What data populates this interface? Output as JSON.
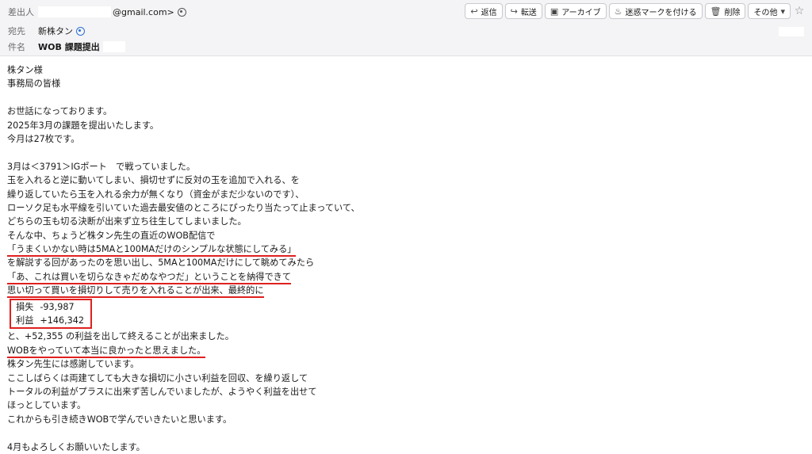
{
  "header": {
    "from_label": "差出人",
    "from_value": "@gmail.com>",
    "to_label": "宛先",
    "to_value": "新株タン",
    "subject_label": "件名",
    "subject_value": "WOB 課題提出"
  },
  "toolbar": {
    "reply": "返信",
    "forward": "転送",
    "archive": "アーカイブ",
    "junk": "迷惑マークを付ける",
    "delete": "削除",
    "more": "その他"
  },
  "body": {
    "greeting1": "株タン様",
    "greeting2": "事務局の皆様",
    "p1_1": "お世話になっております。",
    "p1_2": "2025年3月の課題を提出いたします。",
    "p1_3": "今月は27枚です。",
    "p2_1": "3月は＜3791＞IGポート　で戦っていました。",
    "p2_2": "玉を入れると逆に動いてしまい、損切せずに反対の玉を追加で入れる、を",
    "p2_3": "繰り返していたら玉を入れる余力が無くなり（資金がまだ少ないのです）、",
    "p2_4": "ローソク足も水平線を引いていた過去最安値のところにぴったり当たって止まっていて、",
    "p2_5": "どちらの玉も切る決断が出来ず立ち往生してしまいました。",
    "p2_6": "そんな中、ちょうど株タン先生の直近のWOB配信で",
    "p2_7": "「うまくいかない時は5MAと100MAだけのシンプルな状態にしてみる」",
    "p2_8": "を解説する回があったのを思い出し、5MAと100MAだけにして眺めてみたら",
    "p2_9": "「あ、これは買いを切らなきゃだめなやつだ」ということを納得できて",
    "p2_10": "思い切って買いを損切りして売りを入れることが出来、最終的に",
    "loss_label": "損失",
    "loss_value": "-93,987",
    "profit_label": "利益",
    "profit_value": "+146,342",
    "p2_11": "と、+52,355 の利益を出して終えることが出来ました。",
    "p2_12": "WOBをやっていて本当に良かったと思えました。",
    "p2_13": "株タン先生には感謝しています。",
    "p2_14": "ここしばらくは両建てしても大きな損切に小さい利益を回収、を繰り返して",
    "p2_15": "トータルの利益がプラスに出来ず苦しんでいましたが、ようやく利益を出せて",
    "p2_16": "ほっとしています。",
    "p2_17": "これからも引き続きWOBで学んでいきたいと思います。",
    "closing": "4月もよろしくお願いいたします。"
  },
  "colors": {
    "accent_underline": "#e02020",
    "header_bg": "#f4f4f6"
  }
}
